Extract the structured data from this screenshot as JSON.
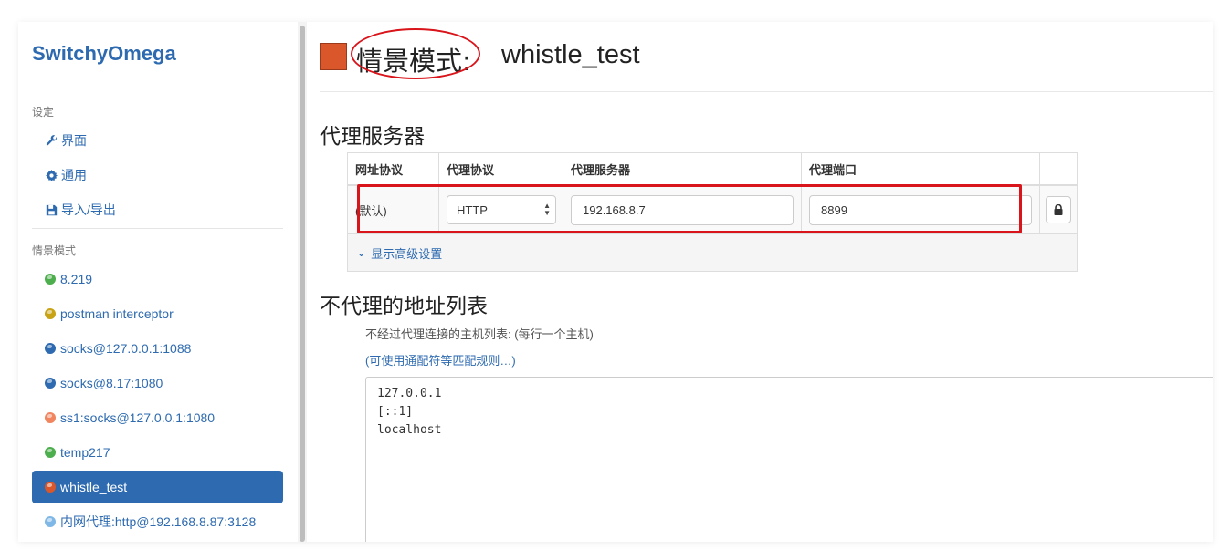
{
  "app": {
    "brand": "SwitchyOmega"
  },
  "sidebar": {
    "settings_header": "设定",
    "settings_items": [
      {
        "label": "界面",
        "icon": "wrench-icon"
      },
      {
        "label": "通用",
        "icon": "gear-icon"
      },
      {
        "label": "导入/导出",
        "icon": "floppy-icon"
      }
    ],
    "profiles_header": "情景模式",
    "profiles": [
      {
        "label": "8.219",
        "color": "#4cae4c"
      },
      {
        "label": "postman interceptor",
        "color": "#c8a316"
      },
      {
        "label": "socks@127.0.0.1:1088",
        "color": "#2d6ab0"
      },
      {
        "label": "socks@8.17:1080",
        "color": "#2d6ab0"
      },
      {
        "label": "ss1:socks@127.0.0.1:1080",
        "color": "#f0855f"
      },
      {
        "label": "temp217",
        "color": "#4cae4c"
      },
      {
        "label": "whistle_test",
        "color": "#d9572a",
        "active": true
      },
      {
        "label": "内网代理:http@192.168.8.87:3128",
        "color": "#7fb8e6"
      }
    ]
  },
  "header": {
    "prefix": "情景模式:",
    "title": "whistle_test",
    "swatch_color": "#d9572a"
  },
  "proxy_servers": {
    "heading": "代理服务器",
    "columns": [
      "网址协议",
      "代理协议",
      "代理服务器",
      "代理端口"
    ],
    "row": {
      "scheme": "(默认)",
      "protocol": "HTTP",
      "server": "192.168.8.7",
      "port": "8899"
    },
    "advanced_label": "显示高级设置"
  },
  "bypass": {
    "heading": "不代理的地址列表",
    "description": "不经过代理连接的主机列表: (每行一个主机)",
    "wildcard_link": "(可使用通配符等匹配规则…)",
    "list_text": "127.0.0.1\n[::1]\nlocalhost"
  }
}
